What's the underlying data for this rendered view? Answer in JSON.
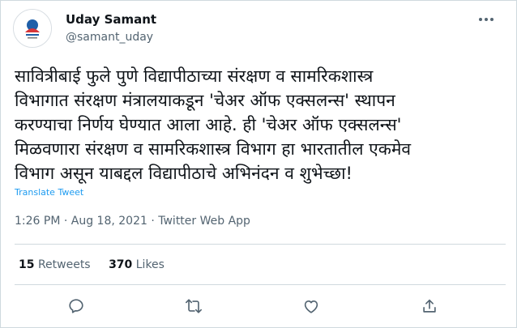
{
  "author": {
    "display_name": "Uday Samant",
    "handle": "@samant_uday",
    "avatar_icon": "avatar-logo-icon"
  },
  "tweet": {
    "text": "सावित्रीबाई फुले पुणे विद्यापीठाच्या संरक्षण व सामरिकशास्त्र\nविभागात संरक्षण मंत्रालयाकडून 'चेअर ऑफ एक्सलन्स' स्थापन\nकरण्याचा निर्णय घेण्यात आला आहे. ही 'चेअर ऑफ एक्सलन्स'\nमिळवणारा संरक्षण व सामरिकशास्त्र विभाग हा भारतातील एकमेव\nविभाग असून याबद्दल विद्यापीठाचे अभिनंदन व शुभेच्छा!",
    "translate_label": "Translate Tweet",
    "meta": "1:26 PM · Aug 18, 2021 · Twitter Web App"
  },
  "stats": {
    "retweets_count": "15",
    "retweets_label": "Retweets",
    "likes_count": "370",
    "likes_label": "Likes"
  },
  "actions": {
    "reply_icon": "reply-icon",
    "retweet_icon": "retweet-icon",
    "like_icon": "like-icon",
    "share_icon": "share-icon"
  },
  "colors": {
    "link_blue": "#1d9bf0",
    "secondary_text": "#536471",
    "primary_text": "#0f1419",
    "border": "#cfd9de"
  }
}
